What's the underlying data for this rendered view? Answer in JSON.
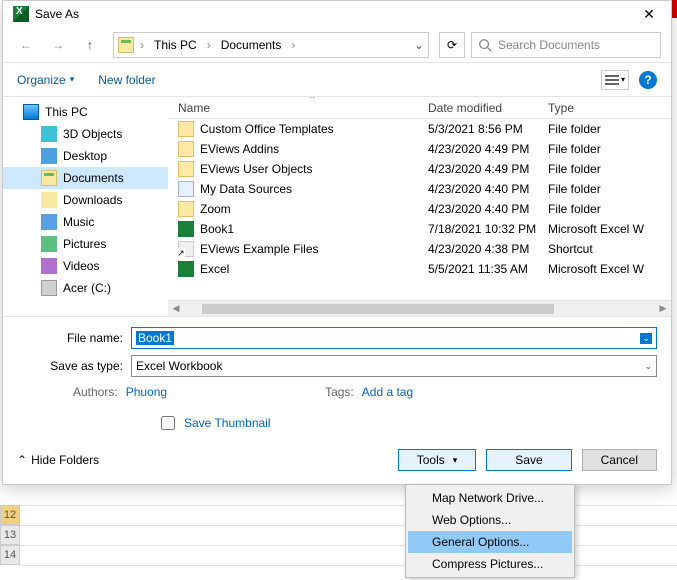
{
  "titlebar": {
    "title": "Save As",
    "close": "✕"
  },
  "nav": {
    "back": "←",
    "fwd": "→",
    "up": "↑",
    "crumbs": [
      "This PC",
      "Documents"
    ],
    "refresh": "⟳",
    "search_placeholder": "Search Documents"
  },
  "toolbar": {
    "organize": "Organize",
    "new_folder": "New folder",
    "help": "?"
  },
  "tree": [
    {
      "label": "This PC",
      "icon": "i-pc",
      "indent": false
    },
    {
      "label": "3D Objects",
      "icon": "i-3d",
      "indent": true
    },
    {
      "label": "Desktop",
      "icon": "i-desktop",
      "indent": true
    },
    {
      "label": "Documents",
      "icon": "i-doc",
      "indent": true,
      "selected": true
    },
    {
      "label": "Downloads",
      "icon": "i-dl",
      "indent": true
    },
    {
      "label": "Music",
      "icon": "i-music",
      "indent": true
    },
    {
      "label": "Pictures",
      "icon": "i-pic",
      "indent": true
    },
    {
      "label": "Videos",
      "icon": "i-vid",
      "indent": true
    },
    {
      "label": "Acer (C:)",
      "icon": "i-drive",
      "indent": true
    }
  ],
  "list": {
    "headers": {
      "name": "Name",
      "date": "Date modified",
      "type": "Type"
    },
    "sort_indicator": "⌃",
    "rows": [
      {
        "name": "Custom Office Templates",
        "date": "5/3/2021 8:56 PM",
        "type": "File folder",
        "icon": "i-folder"
      },
      {
        "name": "EViews Addins",
        "date": "4/23/2020 4:49 PM",
        "type": "File folder",
        "icon": "i-folder"
      },
      {
        "name": "EViews User Objects",
        "date": "4/23/2020 4:49 PM",
        "type": "File folder",
        "icon": "i-folder"
      },
      {
        "name": "My Data Sources",
        "date": "4/23/2020 4:40 PM",
        "type": "File folder",
        "icon": "i-web"
      },
      {
        "name": "Zoom",
        "date": "4/23/2020 4:40 PM",
        "type": "File folder",
        "icon": "i-folder"
      },
      {
        "name": "Book1",
        "date": "7/18/2021 10:32 PM",
        "type": "Microsoft Excel W",
        "icon": "i-xls"
      },
      {
        "name": "EViews Example Files",
        "date": "4/23/2020 4:38 PM",
        "type": "Shortcut",
        "icon": "i-short"
      },
      {
        "name": "Excel",
        "date": "5/5/2021 11:35 AM",
        "type": "Microsoft Excel W",
        "icon": "i-xls"
      }
    ]
  },
  "form": {
    "filename_label": "File name:",
    "filename_value": "Book1",
    "type_label": "Save as type:",
    "type_value": "Excel Workbook",
    "authors_label": "Authors:",
    "authors_value": "Phuong",
    "tags_label": "Tags:",
    "tags_value": "Add a tag",
    "save_thumbnail": "Save Thumbnail"
  },
  "footer": {
    "hide_folders": "Hide Folders",
    "tools": "Tools",
    "save": "Save",
    "cancel": "Cancel"
  },
  "menu": [
    {
      "label": "Map Network Drive..."
    },
    {
      "label": "Web Options..."
    },
    {
      "label": "General Options...",
      "hl": true
    },
    {
      "label": "Compress Pictures..."
    }
  ],
  "sheet": {
    "r12": "12",
    "r13": "13",
    "r14": "14"
  }
}
